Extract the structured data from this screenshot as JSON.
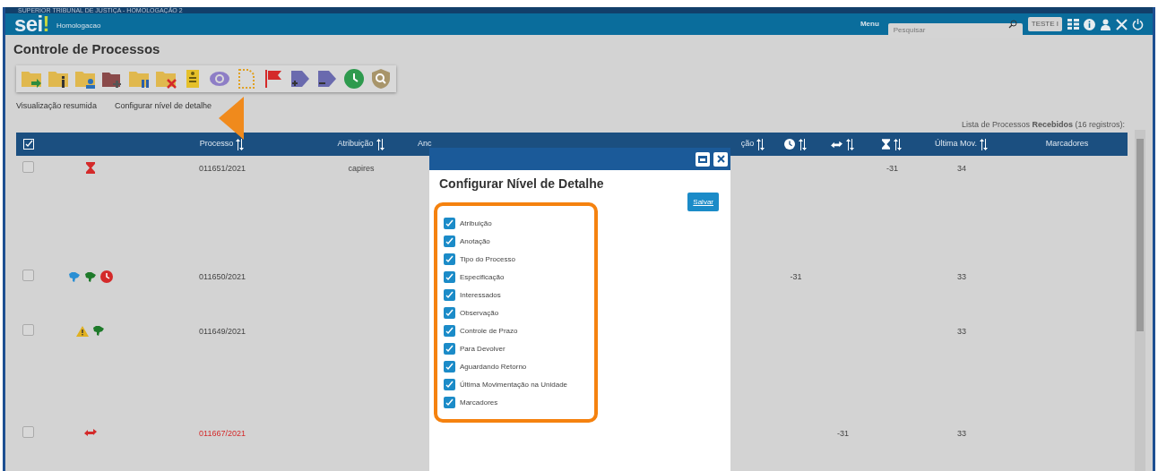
{
  "banner": {
    "org": "SUPERIOR TRIBUNAL DE JUSTIÇA - HOMOLOGAÇÃO 2",
    "logo": "sei",
    "logo_mark": "!",
    "env": "Homologacao",
    "menu": "Menu",
    "search": {
      "placeholder": "Pesquisar"
    },
    "unit": "TESTE I"
  },
  "page_title": "Controle de Processos",
  "links": [
    "Visualização resumida",
    "Configurar nível de detalhe"
  ],
  "list_caption": "Lista de Processos **Recebidos** (16 registros):",
  "table": {
    "columns": [
      {
        "kind": "check",
        "checked": true
      },
      {
        "kind": "blank"
      },
      {
        "kind": "sort",
        "label": "Processo"
      },
      {
        "kind": "sort",
        "label": "Atribuição"
      },
      {
        "kind": "cut",
        "label": "Anc"
      },
      {
        "kind": "sort",
        "label": "ção"
      },
      {
        "kind": "clock-sort"
      },
      {
        "kind": "transfer-sort"
      },
      {
        "kind": "hourglass-sort"
      },
      {
        "kind": "sort",
        "label": "Última Mov."
      },
      {
        "kind": "text",
        "label": "Marcadores"
      }
    ],
    "rows": [
      {
        "checked": false,
        "icons": [
          {
            "kind": "hourglass",
            "color": "#d42a2a"
          }
        ],
        "color": "#444444",
        "cells": [
          "",
          "",
          "011651/2021",
          "capires",
          "",
          "",
          "",
          "",
          "-31",
          "34",
          ""
        ]
      },
      {
        "checked": false,
        "icons": [
          {
            "kind": "map",
            "color": "#2a8fd4"
          },
          {
            "kind": "map",
            "color": "#1e7a2a"
          },
          {
            "kind": "clock",
            "color": "#d42a2a"
          }
        ],
        "color": "#444444",
        "cells": [
          "",
          "",
          "011650/2021",
          "",
          "",
          "",
          "-31",
          "",
          "",
          "33",
          ""
        ]
      },
      {
        "checked": false,
        "icons": [
          {
            "kind": "warning",
            "color": "#e0b020"
          },
          {
            "kind": "map",
            "color": "#1e7a2a"
          }
        ],
        "color": "#444444",
        "cells": [
          "",
          "",
          "011649/2021",
          "",
          "",
          "",
          "",
          "",
          "",
          "33",
          ""
        ]
      },
      {
        "checked": false,
        "icons": [
          {
            "kind": "transfer",
            "color": "#d42a2a"
          }
        ],
        "color": "#d42a2a",
        "cells": [
          "",
          "",
          "011667/2021",
          "",
          "",
          "",
          "",
          "-31",
          "",
          "33",
          ""
        ]
      }
    ]
  },
  "modal": {
    "title": "Configurar Nível de Detalhe",
    "save": "Salvar",
    "options": [
      {
        "label": "Atribuição",
        "checked": true
      },
      {
        "label": "Anotação",
        "checked": true
      },
      {
        "label": "Tipo do Processo",
        "checked": true
      },
      {
        "label": "Especificação",
        "checked": true
      },
      {
        "label": "Interessados",
        "checked": true
      },
      {
        "label": "Observação",
        "checked": true
      },
      {
        "label": "Controle de Prazo",
        "checked": true
      },
      {
        "label": "Para Devolver",
        "checked": true
      },
      {
        "label": "Aguardando Retorno",
        "checked": true
      },
      {
        "label": "Última Movimentação na Unidade",
        "checked": true
      },
      {
        "label": "Marcadores",
        "checked": true
      }
    ]
  }
}
